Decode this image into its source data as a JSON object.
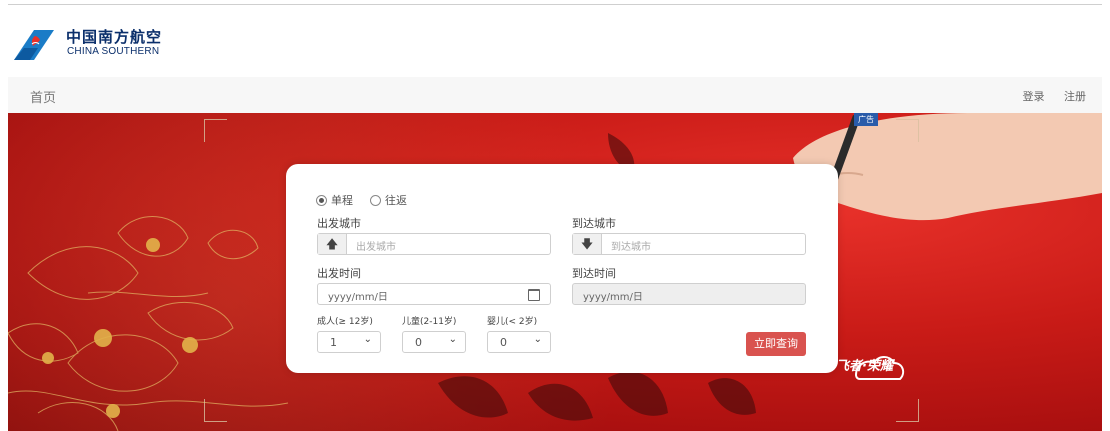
{
  "header": {
    "logo_cn": "中国南方航空",
    "logo_en": "CHINA SOUTHERN"
  },
  "nav": {
    "home": "首页",
    "login": "登录",
    "register": "注册"
  },
  "banner": {
    "ad_label": "广告",
    "brand_text": "飞者·荣耀"
  },
  "search": {
    "trip_types": [
      "单程",
      "往返"
    ],
    "selected_trip": "单程",
    "from_label": "出发城市",
    "from_placeholder": "出发城市",
    "to_label": "到达城市",
    "to_placeholder": "到达城市",
    "depart_label": "出发时间",
    "depart_value": "yyyy/mm/日",
    "return_label": "到达时间",
    "return_value": "yyyy/mm/日",
    "adult_label": "成人(≥ 12岁)",
    "adult_value": "1",
    "child_label": "儿童(2-11岁)",
    "child_value": "0",
    "infant_label": "婴儿(< 2岁)",
    "infant_value": "0",
    "submit": "立即查询"
  },
  "colors": {
    "brand_blue": "#0b2f6b",
    "banner_red": "#c91b17",
    "submit_red": "#d9534f"
  },
  "icons": [
    "up-arrow-icon",
    "down-arrow-icon",
    "calendar-icon",
    "chevron-down-icon"
  ]
}
